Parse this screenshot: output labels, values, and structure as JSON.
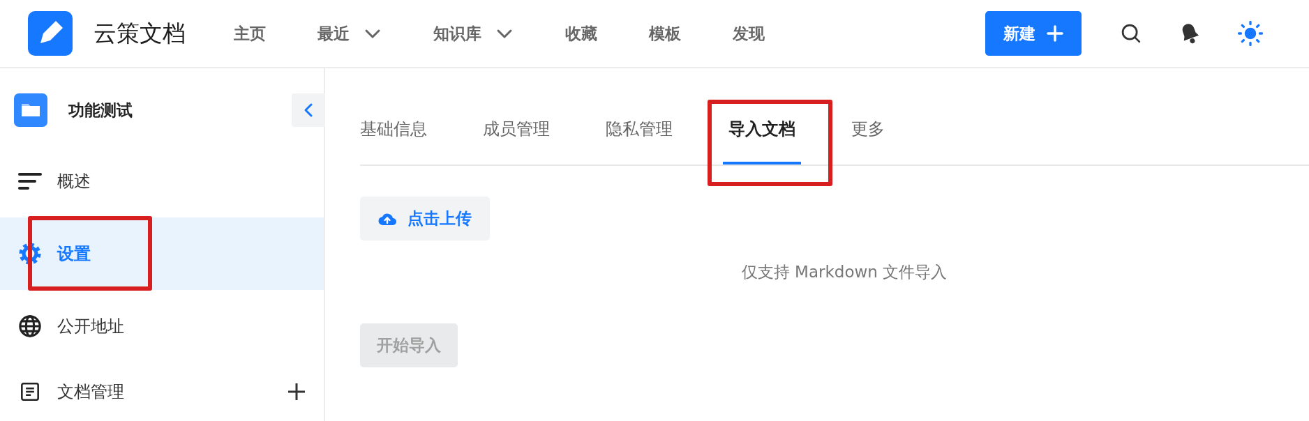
{
  "header": {
    "app_name": "云策文档",
    "nav": [
      {
        "label": "主页",
        "has_menu": false
      },
      {
        "label": "最近",
        "has_menu": true
      },
      {
        "label": "知识库",
        "has_menu": true
      },
      {
        "label": "收藏",
        "has_menu": false
      },
      {
        "label": "模板",
        "has_menu": false
      },
      {
        "label": "发现",
        "has_menu": false
      }
    ],
    "new_button": "新建"
  },
  "sidebar": {
    "space_title": "功能测试",
    "items": [
      {
        "kind": "overview",
        "label": "概述",
        "selected": false,
        "highlighted": false,
        "addable": false
      },
      {
        "kind": "settings",
        "label": "设置",
        "selected": true,
        "highlighted": true,
        "addable": false
      },
      {
        "kind": "public",
        "label": "公开地址",
        "selected": false,
        "highlighted": false,
        "addable": false
      },
      {
        "kind": "docs",
        "label": "文档管理",
        "selected": false,
        "highlighted": false,
        "addable": true
      }
    ]
  },
  "tabs": [
    {
      "label": "基础信息",
      "selected": false,
      "highlighted": false
    },
    {
      "label": "成员管理",
      "selected": false,
      "highlighted": false
    },
    {
      "label": "隐私管理",
      "selected": false,
      "highlighted": false
    },
    {
      "label": "导入文档",
      "selected": true,
      "highlighted": true
    },
    {
      "label": "更多",
      "selected": false,
      "highlighted": false
    }
  ],
  "upload_button": "点击上传",
  "hint": "仅支持 Markdown 文件导入",
  "start_button": {
    "label": "开始导入",
    "disabled": true
  }
}
